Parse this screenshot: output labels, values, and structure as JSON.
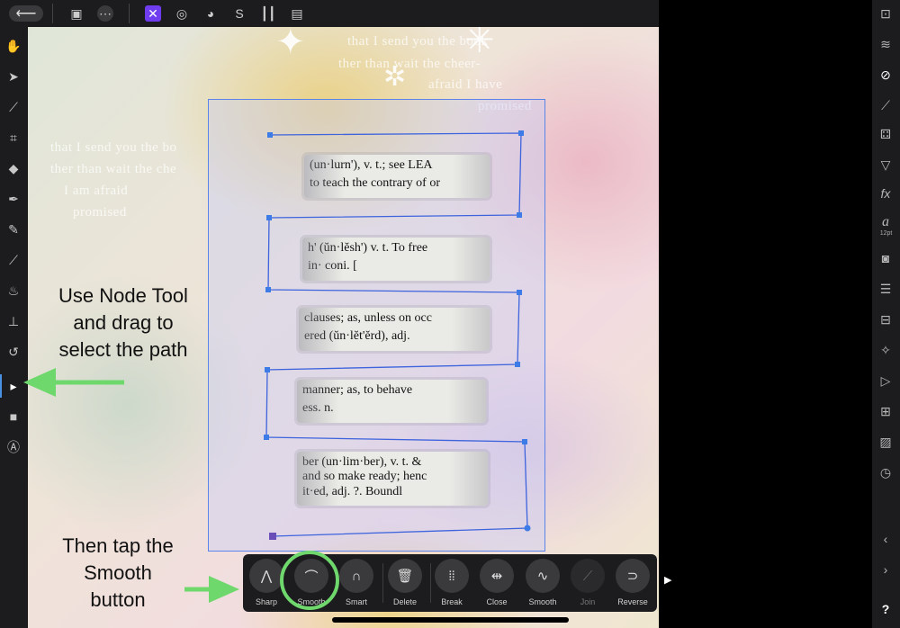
{
  "canvas": {
    "bg_lines": [
      "that I send you the book",
      "ther than wait the cheer-",
      "afraid I have",
      "promised",
      "that I send you the bo",
      "ther than wait the che",
      "I am afraid",
      "promised"
    ],
    "strips": [
      {
        "l1": "(un·lurn'), v. t.; see LEA",
        "l2": "to teach the contrary of or"
      },
      {
        "l1": "h' (ŭn·lĕsh') v. t.  To free",
        "l2": "in·   coni.  ["
      },
      {
        "l1": "clauses; as, unless on occ",
        "l2": "ered (ŭn·lĕt'ĕrd), adj."
      },
      {
        "l1": "manner; as, to behave",
        "l2": "ess. n."
      },
      {
        "l1": "ber (un·lim·ber), v. t. &",
        "l2": "and so make ready; henc",
        "l3": "it·ed, adj.  ?. Boundl"
      }
    ]
  },
  "top_toolbar": {
    "back_icon": "back-arrow-icon",
    "icons": [
      "document-icon",
      "more-icon",
      "designer-persona-icon",
      "pixel-persona-icon",
      "export-persona-icon",
      "snapping-icon",
      "alignment-icon",
      "arrange-icon"
    ]
  },
  "left_toolbar": {
    "tools": [
      "hand-icon",
      "move-icon",
      "color-picker-icon",
      "crop-icon",
      "fill-icon",
      "pen-icon",
      "pencil-icon",
      "brush-icon",
      "flame-icon",
      "stamp-icon",
      "curve-icon",
      "node-tool-icon",
      "rectangle-icon",
      "text-frame-icon"
    ]
  },
  "right_panel": {
    "text_style_label": "12pt",
    "help_label": "?"
  },
  "context_toolbar": {
    "buttons": [
      {
        "label": "Sharp",
        "icon": "sharp-node-icon",
        "enabled": true
      },
      {
        "label": "Smooth",
        "icon": "smooth-node-icon",
        "enabled": true
      },
      {
        "label": "Smart",
        "icon": "smart-node-icon",
        "enabled": true
      },
      {
        "label": "Delete",
        "icon": "trash-icon",
        "enabled": true
      },
      {
        "label": "Break",
        "icon": "break-curve-icon",
        "enabled": true
      },
      {
        "label": "Close",
        "icon": "close-curve-icon",
        "enabled": true
      },
      {
        "label": "Smooth",
        "icon": "smooth-curve-icon",
        "enabled": true
      },
      {
        "label": "Join",
        "icon": "join-curves-icon",
        "enabled": false
      },
      {
        "label": "Reverse",
        "icon": "reverse-curve-icon",
        "enabled": true
      }
    ],
    "more_icon": "play-right-icon"
  },
  "annotations": {
    "node_tool_text": "Use Node Tool and drag to select the path",
    "node_tool_lines": [
      "Use Node Tool",
      "and drag to",
      "select the path"
    ],
    "smooth_text_lines": [
      "Then tap the",
      "Smooth",
      "button"
    ]
  },
  "colors": {
    "selection_blue": "#5b84ea",
    "annotation_green": "#6fd86c",
    "accent_purple": "#6f3cf0"
  }
}
